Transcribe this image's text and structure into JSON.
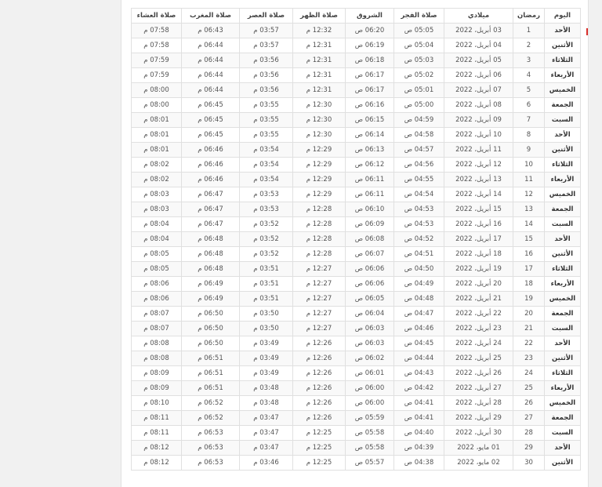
{
  "table": {
    "headers": [
      "اليوم",
      "رمضان",
      "ميلادي",
      "صلاة الفجر",
      "الشروق",
      "صلاة الظهر",
      "صلاة العصر",
      "صلاة المغرب",
      "صلاة العشاء"
    ],
    "rows": [
      [
        "الأحد",
        "1",
        "03 أبريل، 2022",
        "05:05 ص",
        "06:20 ص",
        "12:32 م",
        "03:57 م",
        "06:43 م",
        "07:58 م"
      ],
      [
        "الأثنين",
        "2",
        "04 أبريل، 2022",
        "05:04 ص",
        "06:19 ص",
        "12:31 م",
        "03:57 م",
        "06:44 م",
        "07:58 م"
      ],
      [
        "الثلاثاء",
        "3",
        "05 أبريل، 2022",
        "05:03 ص",
        "06:18 ص",
        "12:31 م",
        "03:56 م",
        "06:44 م",
        "07:59 م"
      ],
      [
        "الأربعاء",
        "4",
        "06 أبريل، 2022",
        "05:02 ص",
        "06:17 ص",
        "12:31 م",
        "03:56 م",
        "06:44 م",
        "07:59 م"
      ],
      [
        "الخميس",
        "5",
        "07 أبريل، 2022",
        "05:01 ص",
        "06:17 ص",
        "12:31 م",
        "03:56 م",
        "06:44 م",
        "08:00 م"
      ],
      [
        "الجمعة",
        "6",
        "08 أبريل، 2022",
        "05:00 ص",
        "06:16 ص",
        "12:30 م",
        "03:55 م",
        "06:45 م",
        "08:00 م"
      ],
      [
        "السبت",
        "7",
        "09 أبريل، 2022",
        "04:59 ص",
        "06:15 ص",
        "12:30 م",
        "03:55 م",
        "06:45 م",
        "08:01 م"
      ],
      [
        "الأحد",
        "8",
        "10 أبريل، 2022",
        "04:58 ص",
        "06:14 ص",
        "12:30 م",
        "03:55 م",
        "06:45 م",
        "08:01 م"
      ],
      [
        "الأثنين",
        "9",
        "11 أبريل، 2022",
        "04:57 ص",
        "06:13 ص",
        "12:29 م",
        "03:54 م",
        "06:46 م",
        "08:01 م"
      ],
      [
        "الثلاثاء",
        "10",
        "12 أبريل، 2022",
        "04:56 ص",
        "06:12 ص",
        "12:29 م",
        "03:54 م",
        "06:46 م",
        "08:02 م"
      ],
      [
        "الأربعاء",
        "11",
        "13 أبريل، 2022",
        "04:55 ص",
        "06:11 ص",
        "12:29 م",
        "03:54 م",
        "06:46 م",
        "08:02 م"
      ],
      [
        "الخميس",
        "12",
        "14 أبريل، 2022",
        "04:54 ص",
        "06:11 ص",
        "12:29 م",
        "03:53 م",
        "06:47 م",
        "08:03 م"
      ],
      [
        "الجمعة",
        "13",
        "15 أبريل، 2022",
        "04:53 ص",
        "06:10 ص",
        "12:28 م",
        "03:53 م",
        "06:47 م",
        "08:03 م"
      ],
      [
        "السبت",
        "14",
        "16 أبريل، 2022",
        "04:53 ص",
        "06:09 ص",
        "12:28 م",
        "03:52 م",
        "06:47 م",
        "08:04 م"
      ],
      [
        "الأحد",
        "15",
        "17 أبريل، 2022",
        "04:52 ص",
        "06:08 ص",
        "12:28 م",
        "03:52 م",
        "06:48 م",
        "08:04 م"
      ],
      [
        "الأثنين",
        "16",
        "18 أبريل، 2022",
        "04:51 ص",
        "06:07 ص",
        "12:28 م",
        "03:52 م",
        "06:48 م",
        "08:05 م"
      ],
      [
        "الثلاثاء",
        "17",
        "19 أبريل، 2022",
        "04:50 ص",
        "06:06 ص",
        "12:27 م",
        "03:51 م",
        "06:48 م",
        "08:05 م"
      ],
      [
        "الأربعاء",
        "18",
        "20 أبريل، 2022",
        "04:49 ص",
        "06:06 ص",
        "12:27 م",
        "03:51 م",
        "06:49 م",
        "08:06 م"
      ],
      [
        "الخميس",
        "19",
        "21 أبريل، 2022",
        "04:48 ص",
        "06:05 ص",
        "12:27 م",
        "03:51 م",
        "06:49 م",
        "08:06 م"
      ],
      [
        "الجمعة",
        "20",
        "22 أبريل، 2022",
        "04:47 ص",
        "06:04 ص",
        "12:27 م",
        "03:50 م",
        "06:50 م",
        "08:07 م"
      ],
      [
        "السبت",
        "21",
        "23 أبريل، 2022",
        "04:46 ص",
        "06:03 ص",
        "12:27 م",
        "03:50 م",
        "06:50 م",
        "08:07 م"
      ],
      [
        "الأحد",
        "22",
        "24 أبريل، 2022",
        "04:45 ص",
        "06:03 ص",
        "12:26 م",
        "03:49 م",
        "06:50 م",
        "08:08 م"
      ],
      [
        "الأثنين",
        "23",
        "25 أبريل، 2022",
        "04:44 ص",
        "06:02 ص",
        "12:26 م",
        "03:49 م",
        "06:51 م",
        "08:08 م"
      ],
      [
        "الثلاثاء",
        "24",
        "26 أبريل، 2022",
        "04:43 ص",
        "06:01 ص",
        "12:26 م",
        "03:49 م",
        "06:51 م",
        "08:09 م"
      ],
      [
        "الأربعاء",
        "25",
        "27 أبريل، 2022",
        "04:42 ص",
        "06:00 ص",
        "12:26 م",
        "03:48 م",
        "06:51 م",
        "08:09 م"
      ],
      [
        "الخميس",
        "26",
        "28 أبريل، 2022",
        "04:41 ص",
        "06:00 ص",
        "12:26 م",
        "03:48 م",
        "06:52 م",
        "08:10 م"
      ],
      [
        "الجمعة",
        "27",
        "29 أبريل، 2022",
        "04:41 ص",
        "05:59 ص",
        "12:26 م",
        "03:47 م",
        "06:52 م",
        "08:11 م"
      ],
      [
        "السبت",
        "28",
        "30 أبريل، 2022",
        "04:40 ص",
        "05:58 ص",
        "12:25 م",
        "03:47 م",
        "06:53 م",
        "08:11 م"
      ],
      [
        "الأحد",
        "29",
        "01 مايو، 2022",
        "04:39 ص",
        "05:58 ص",
        "12:25 م",
        "03:47 م",
        "06:53 م",
        "08:12 م"
      ],
      [
        "الأثنين",
        "30",
        "02 مايو، 2022",
        "04:38 ص",
        "05:57 ص",
        "12:25 م",
        "03:46 م",
        "06:53 م",
        "08:12 م"
      ]
    ]
  },
  "colors": {
    "page_background": "#f1f1f1",
    "card_background": "#ffffff",
    "row_stripe": "#f9f9f9",
    "border": "#e0e0e0",
    "edge_accent": "#d9302c"
  }
}
